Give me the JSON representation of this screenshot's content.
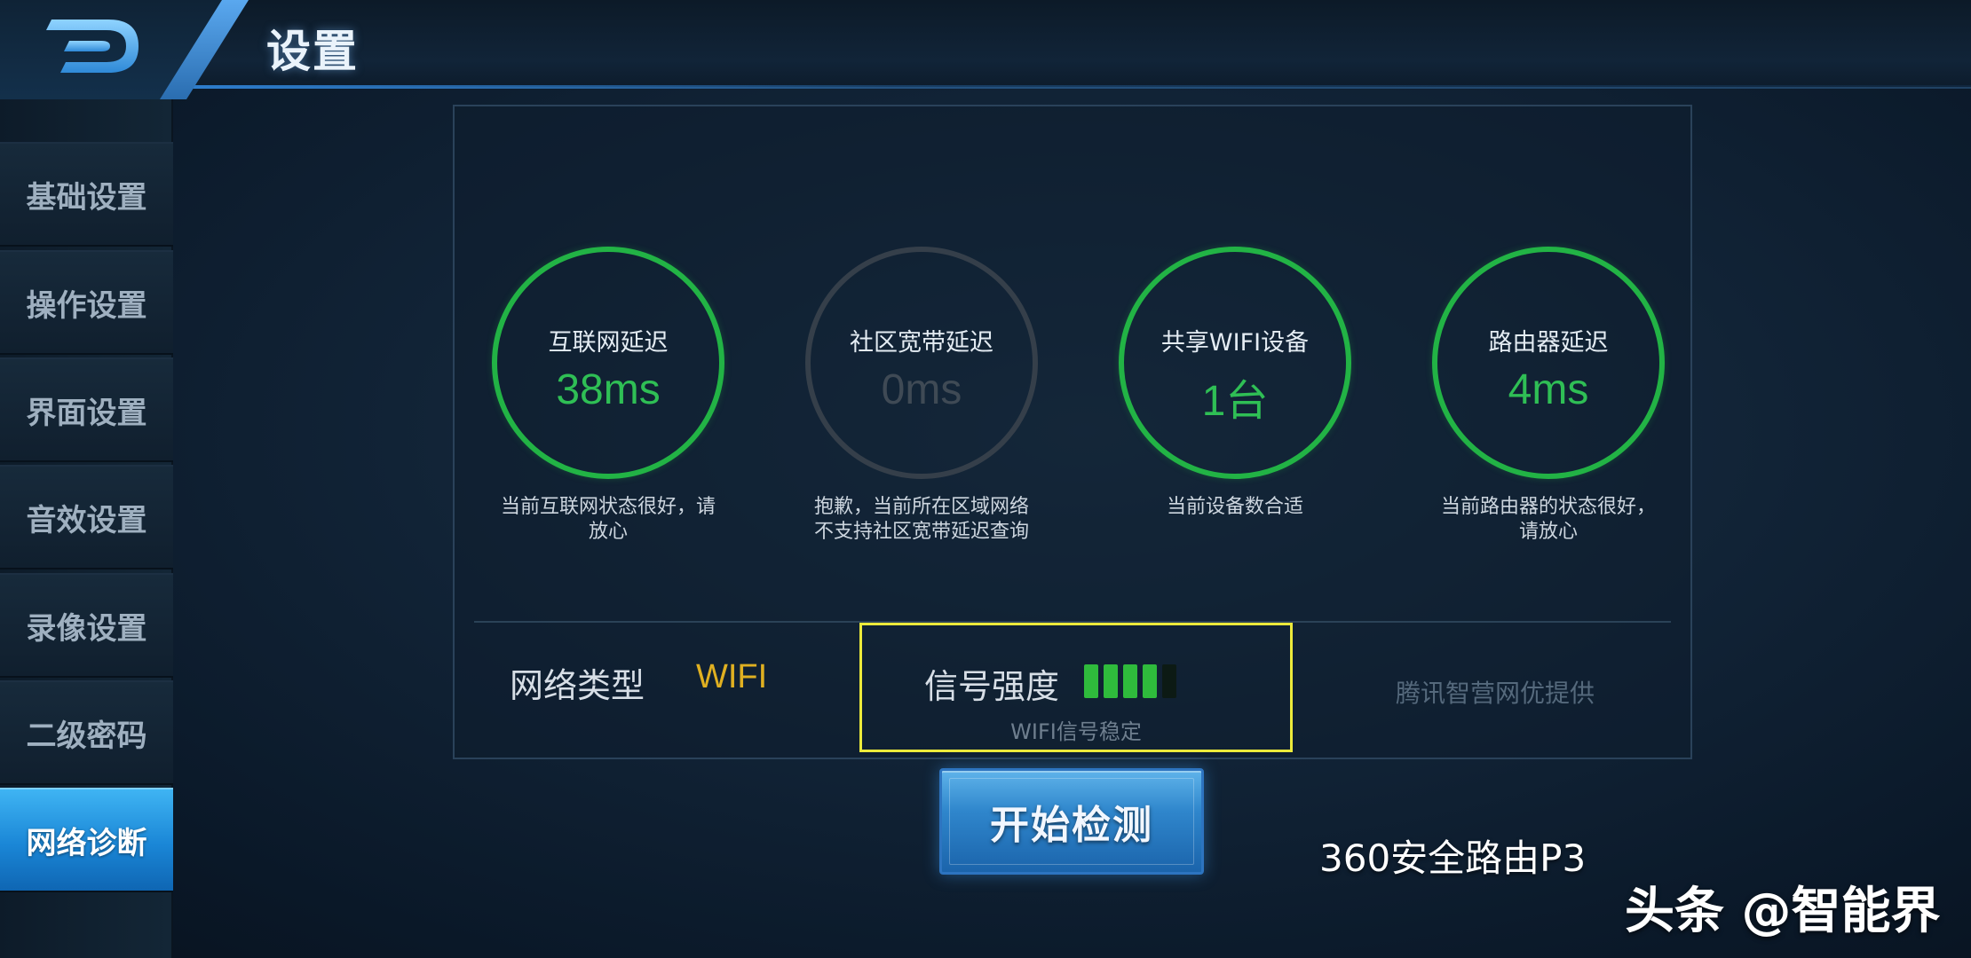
{
  "header": {
    "title": "设置",
    "back_icon": "back-d-icon"
  },
  "sidebar": {
    "items": [
      {
        "label": "基础设置",
        "active": false
      },
      {
        "label": "操作设置",
        "active": false
      },
      {
        "label": "界面设置",
        "active": false
      },
      {
        "label": "音效设置",
        "active": false
      },
      {
        "label": "录像设置",
        "active": false
      },
      {
        "label": "二级密码",
        "active": false
      },
      {
        "label": "网络诊断",
        "active": true
      }
    ]
  },
  "diagnostics": {
    "gauges": [
      {
        "label": "互联网延迟",
        "value": "38ms",
        "status": "ok",
        "desc": "当前互联网状态很好，请放心"
      },
      {
        "label": "社区宽带延迟",
        "value": "0ms",
        "status": "off",
        "desc": "抱歉，当前所在区域网络不支持社区宽带延迟查询"
      },
      {
        "label": "共享WIFI设备",
        "value": "1台",
        "status": "ok",
        "desc": "当前设备数合适"
      },
      {
        "label": "路由器延迟",
        "value": "4ms",
        "status": "ok",
        "desc": "当前路由器的状态很好，请放心"
      }
    ],
    "network_type_label": "网络类型",
    "network_type_value": "WIFI",
    "signal_label": "信号强度",
    "signal_level": 4,
    "signal_max": 5,
    "signal_status": "WIFI信号稳定",
    "provider": "腾讯智营网优提供"
  },
  "start_button": {
    "label": "开始检测"
  },
  "overlay": {
    "caption": "360安全路由P3",
    "watermark": "头条 @智能界"
  },
  "colors": {
    "ok_ring": "#22b345",
    "off_ring": "#353f4a",
    "wifi_value": "#e0b021",
    "highlight_box": "#ecea3b",
    "active_tab": "#1a86d6"
  }
}
